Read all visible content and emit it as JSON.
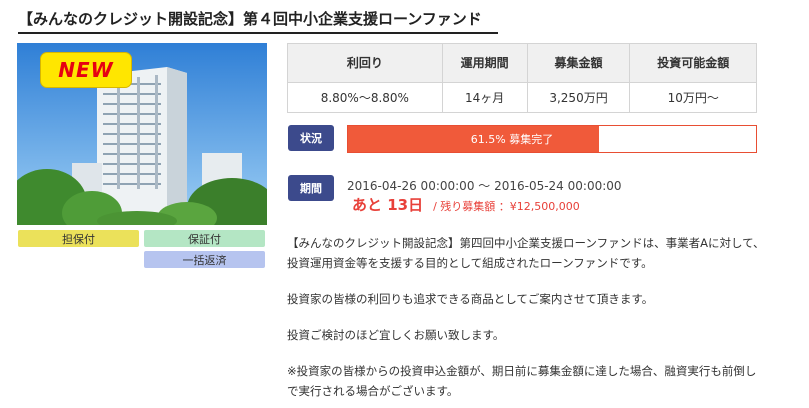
{
  "title": "【みんなのクレジット開設記念】第４回中小企業支援ローンファンド",
  "badge": "NEW",
  "tags": {
    "secured": "担保付",
    "guaranteed": "保証付",
    "bullet": "一括返済"
  },
  "table": {
    "headers": [
      "利回り",
      "運用期間",
      "募集金額",
      "投資可能金額"
    ],
    "values": [
      "8.80%〜8.80%",
      "14ヶ月",
      "3,250万円",
      "10万円〜"
    ]
  },
  "status": {
    "label": "状況",
    "progress_percent": 61.5,
    "progress_text": "61.5% 募集完了"
  },
  "period": {
    "label": "期間",
    "range": "2016-04-26 00:00:00 〜 2016-05-24 00:00:00",
    "days_left": "あと 13日",
    "remaining": "/ 残り募集額 ：¥12,500,000"
  },
  "description": [
    "【みんなのクレジット開設記念】第四回中小企業支援ローンファンドは、事業者Aに対して、投資運用資金等を支援する目的として組成されたローンファンドです。",
    "投資家の皆様の利回りも追求できる商品としてご案内させて頂きます。",
    "投資ご検討のほど宜しくお願い致します。",
    "※投資家の皆様からの投資申込金額が、期日前に募集金額に達した場合、融資実行も前倒しで実行される場合がございます。"
  ],
  "colors": {
    "label_bg": "#3c4a8c",
    "progress_fill": "#f05a3a",
    "accent_red": "#e8413a"
  }
}
